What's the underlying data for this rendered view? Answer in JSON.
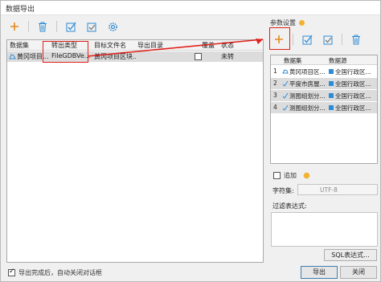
{
  "window": {
    "title": "数据导出"
  },
  "toolbar": {
    "add_icon": "plus-icon",
    "delete_icon": "trash-icon",
    "select_all_icon": "check-all-icon",
    "select_invert_icon": "check-invert-icon",
    "settings_icon": "gear-icon"
  },
  "export_table": {
    "columns": [
      "数据集",
      "转出类型",
      "目标文件名",
      "导出目录",
      "覆盖",
      "状态"
    ],
    "rows": [
      {
        "dataset": "黄冈项目...",
        "type": "FileGDBVe...",
        "target": "黄冈项目区块...",
        "directory": "",
        "overwrite": false,
        "status": "未转"
      }
    ]
  },
  "right": {
    "group_title": "参数设置",
    "source_columns": [
      "",
      "数据集",
      "数据源"
    ],
    "sources": [
      {
        "index": "1",
        "dataset": "黄冈项目区...",
        "source": "全国行政区...",
        "icon": "region-icon"
      },
      {
        "index": "2",
        "dataset": "平度市房屋...",
        "source": "全国行政区...",
        "icon": "line-icon"
      },
      {
        "index": "3",
        "dataset": "测图组划分...",
        "source": "全国行政区...",
        "icon": "line-icon"
      },
      {
        "index": "4",
        "dataset": "测图组划分...",
        "source": "全国行政区...",
        "icon": "line-icon"
      }
    ],
    "append_label": "追加",
    "charset_label": "字符集:",
    "charset_value": "UTF-8",
    "filter_label": "过滤表达式:",
    "sql_button": "SQL表达式..."
  },
  "footer": {
    "close_after_label": "导出完成后，自动关闭对话框",
    "export_button": "导出",
    "close_button": "关闭"
  },
  "colors": {
    "highlight": "#e0201a",
    "accent": "#2e8bd6",
    "row_selected": "#dcdcdc"
  }
}
